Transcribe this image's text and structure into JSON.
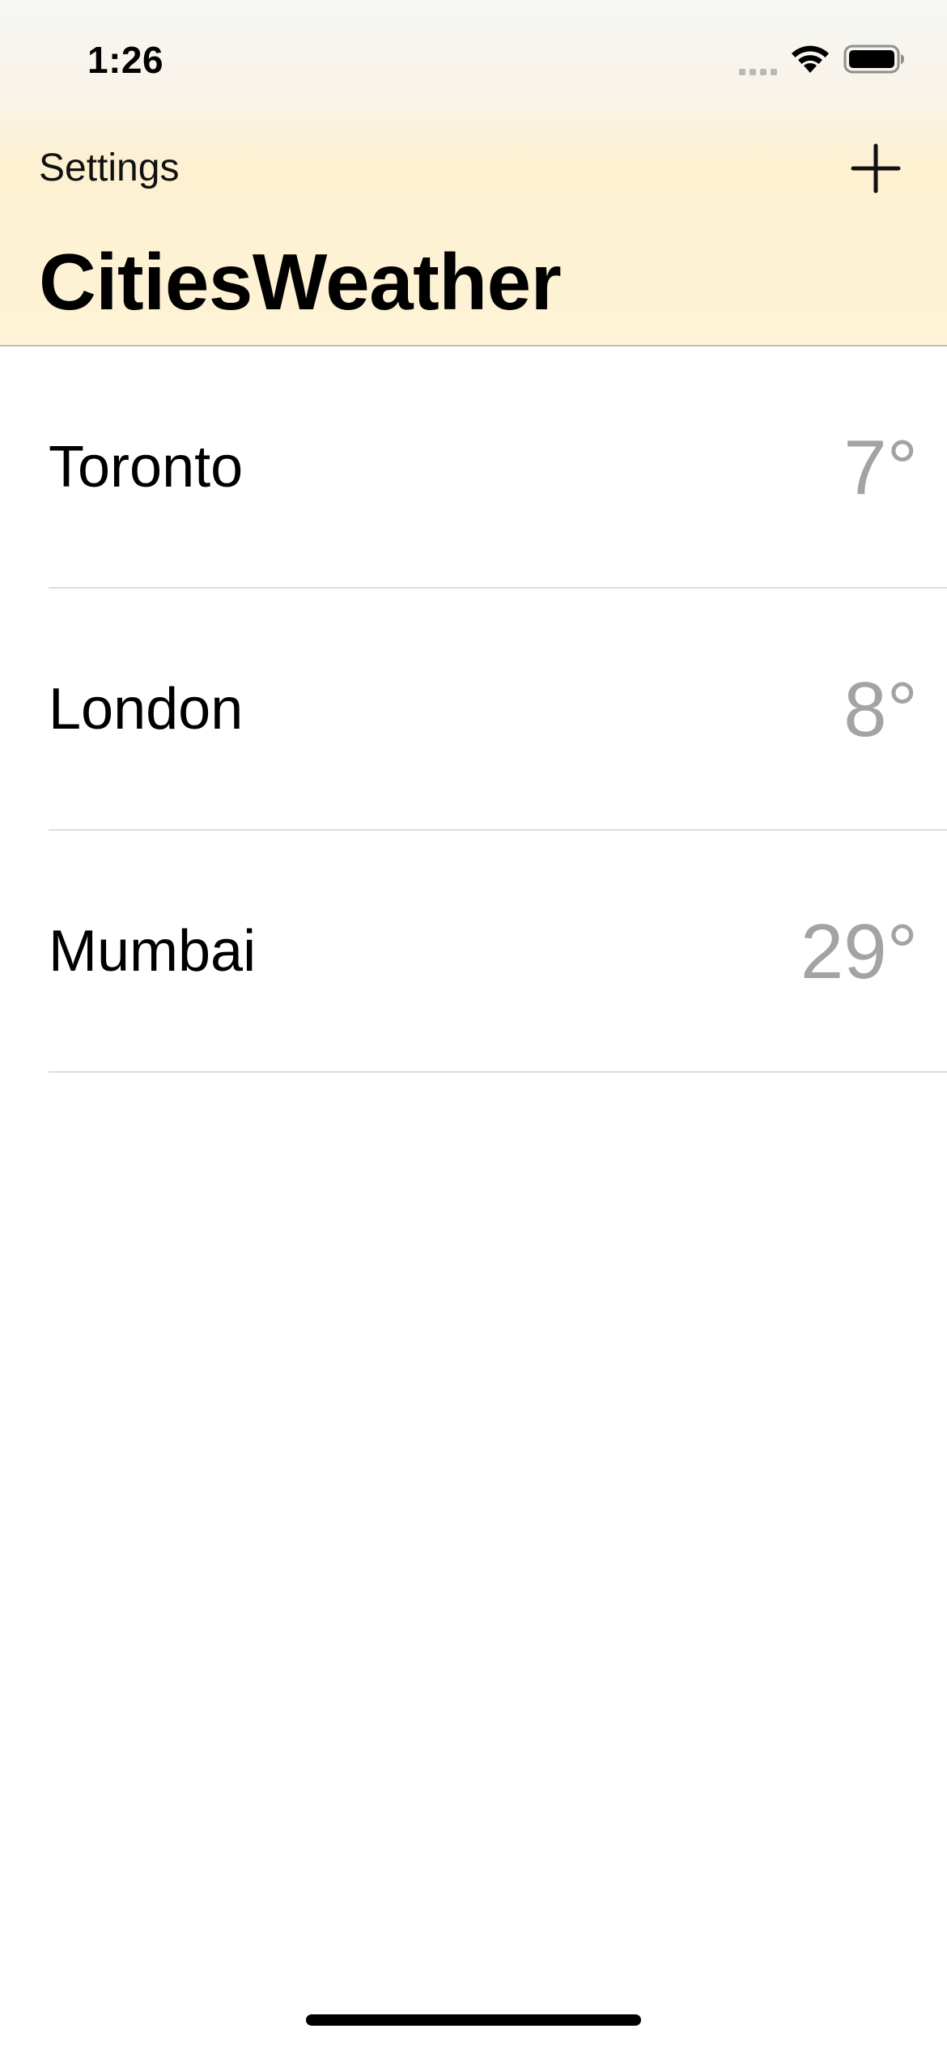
{
  "status_bar": {
    "time": "1:26",
    "signal_icon": "cellular-signal-icon",
    "wifi_icon": "wifi-icon",
    "battery_icon": "battery-icon"
  },
  "nav": {
    "left_label": "Settings",
    "add_icon": "plus-icon",
    "title": "CitiesWeather"
  },
  "cities": [
    {
      "name": "Toronto",
      "temp": "7°"
    },
    {
      "name": "London",
      "temp": "8°"
    },
    {
      "name": "Mumbai",
      "temp": "29°"
    }
  ],
  "colors": {
    "header_tint": "#fef3d6",
    "temp_text": "#a3a3a3",
    "separator": "#dddddd"
  }
}
